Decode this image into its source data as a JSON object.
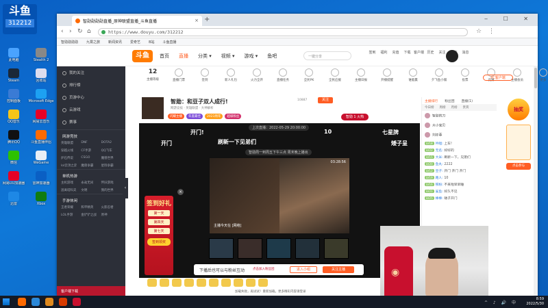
{
  "overlay": {
    "logo": "斗鱼",
    "room": "312212"
  },
  "desktop": {
    "icons": [
      {
        "label": "此电脑",
        "color": "#4aa3ff"
      },
      {
        "label": "Stealth 2",
        "color": "#888"
      },
      {
        "label": "Steam",
        "color": "#1b2838"
      },
      {
        "label": "回收站",
        "color": "#dde"
      },
      {
        "label": "控制面板",
        "color": "#3a7bd5"
      },
      {
        "label": "Microsoft Edge",
        "color": "#1da1f2"
      },
      {
        "label": "QQ音乐",
        "color": "#f5c518"
      },
      {
        "label": "网易云音乐",
        "color": "#e60026"
      },
      {
        "label": "腾讯QQ",
        "color": "#111"
      },
      {
        "label": "斗鱼直播伴侣",
        "color": "#ff6a00"
      },
      {
        "label": "微信",
        "color": "#2dc100"
      },
      {
        "label": "WeGame",
        "color": "#e8eef5"
      },
      {
        "label": "网易UU加速器",
        "color": "#e60026"
      },
      {
        "label": "雷神加速器",
        "color": "#0a5fc4"
      },
      {
        "label": "迅雷",
        "color": "#1e88e5"
      },
      {
        "label": "Xbox",
        "color": "#107c10"
      }
    ]
  },
  "browser": {
    "tab_title": "智勋勋勋勋直播_原神联盟直播_斗鱼直播",
    "new_tab": "+",
    "window_controls": "‒ ☐ ✕",
    "url": "https://www.douyu.com/312212",
    "bookmarks": [
      "智勋勋勋勋",
      "九霄之旅",
      "新闻资讯",
      "爱奇艺",
      "B站",
      "斗鱼直播"
    ]
  },
  "site": {
    "logo": "斗鱼",
    "nav": [
      "首页",
      "直播",
      "分类 ▾",
      "视频 ▾",
      "游戏 ▾",
      "鱼吧"
    ],
    "search_placeholder": "一键分享",
    "header_icons": [
      "签到",
      "福利",
      "充值",
      "下载",
      "客户端",
      "历史",
      "关注",
      "创作",
      "消息"
    ]
  },
  "sidebar": {
    "top": [
      "我的关注",
      "排行榜",
      "页游中心",
      "云游戏",
      "赛事"
    ],
    "sections": [
      {
        "title": "网游竞技",
        "items": [
          "英雄联盟",
          "DNF",
          "DOTA2",
          "穿越火线",
          "CF手游",
          "QQ飞车",
          "炉石传说",
          "CSGO",
          "魔兽世界",
          "lol云顶之弈",
          "魔兽争霸",
          "星际争霸"
        ]
      },
      {
        "title": "单机热游",
        "items": [
          "主机游戏",
          "永劫无间",
          "怀旧游戏",
          "逃离塔科夫",
          "文明",
          "我的世界"
        ]
      },
      {
        "title": "手游休闲",
        "items": [
          "王者荣耀",
          "和平精英",
          "火影忍者",
          "LOL手游",
          "金铲铲之战",
          "原神"
        ]
      }
    ],
    "bottom": "客户端下载"
  },
  "categories": [
    {
      "label": "主播等级",
      "big": "12"
    },
    {
      "label": "直播门票"
    },
    {
      "label": "签到"
    },
    {
      "label": "新人礼包"
    },
    {
      "label": "火力全开"
    },
    {
      "label": "直播任务"
    },
    {
      "label": "全民PK"
    },
    {
      "label": "全民应援"
    },
    {
      "label": "主播日报"
    },
    {
      "label": "开播提醒"
    },
    {
      "label": "谁能赢"
    },
    {
      "label": "夕飞鱼小铺"
    },
    {
      "label": "投票"
    },
    {
      "label": "竞猜"
    },
    {
      "label": "主播会员"
    },
    {
      "label": "更多"
    }
  ],
  "pc_button": "PC客户端",
  "streamer": {
    "title": "智勋：和豆子双人成行!",
    "meta": "网游竞技 · 英雄联盟 · 大神解析",
    "nick": "智勋",
    "tags": [
      {
        "text": "闪耀主播",
        "color": "#ff5d23"
      },
      {
        "text": "年度最佳",
        "color": "#7b4bd8"
      },
      {
        "text": "2023周年",
        "color": "#ff9f1a"
      },
      {
        "text": "超级粉丝",
        "color": "#d22f6a"
      }
    ],
    "follow_count": "10887",
    "follow_label": "关注",
    "yu_button": "智勋 1 火热"
  },
  "video": {
    "live_tag": "上次直播：2022-05-29 20:00:00",
    "danmaku": [
      "开门!",
      "10",
      "七星牌",
      "开门",
      "刷新一下见弟们",
      "矮子呈"
    ],
    "sub_banner": "智勋周一到周五下午三点 周末晚上播出",
    "inner_time": "03:28:56",
    "inner_note": "主播今天在 [网络]",
    "promo_title": "签到好礼",
    "promo_days": [
      "第一天",
      "第四天",
      "第七天"
    ],
    "promo_cta": "签到领奖",
    "promo_close": "×",
    "toast_text": "下播后也可以与粉丝互动",
    "toast_sub": "点击加入粉丝团",
    "toast_btn1": "进入小组",
    "toast_btn2": "关注主播",
    "footer_hint": "加载失败，再试试！重新加载。更多精彩内容请登录",
    "gift_count": 10
  },
  "chat": {
    "tabs": [
      "主播排行",
      "粉丝团",
      "直播(1)"
    ],
    "subtabs": [
      "今日榜",
      "周榜",
      "月榜",
      "贵宾"
    ],
    "ranks": [
      {
        "nick": "智勋的刀"
      },
      {
        "nick": "大小宝贝"
      },
      {
        "nick": "刘亦菲"
      }
    ],
    "messages": [
      {
        "lv": "LV18",
        "nick": "吟唱:",
        "text": "上车!"
      },
      {
        "lv": "LV22",
        "nick": "无名:",
        "text": "好好的"
      },
      {
        "lv": "LV15",
        "nick": "大米:",
        "text": "刷新一下，兄弟们"
      },
      {
        "lv": "LV20",
        "nick": "鱼丸:",
        "text": "2222"
      },
      {
        "lv": "LV12",
        "nick": "豆子:",
        "text": "开门 开门 开门"
      },
      {
        "lv": "LV19",
        "nick": "路人:",
        "text": "10"
      },
      {
        "lv": "LV16",
        "nick": "铁粉:",
        "text": "不来啦早早睡"
      },
      {
        "lv": "LV21",
        "nick": "鲨鱼:",
        "text": "好久不见"
      },
      {
        "lv": "LV25",
        "nick": "棒棒:",
        "text": "矮子开门"
      }
    ]
  },
  "promo": {
    "ring": "抽奖",
    "cta": "点击参与"
  },
  "taskbar": {
    "time": "8:59",
    "date": "2022/5/30",
    "tray_icons": "^ ♪ 🔊 中"
  }
}
